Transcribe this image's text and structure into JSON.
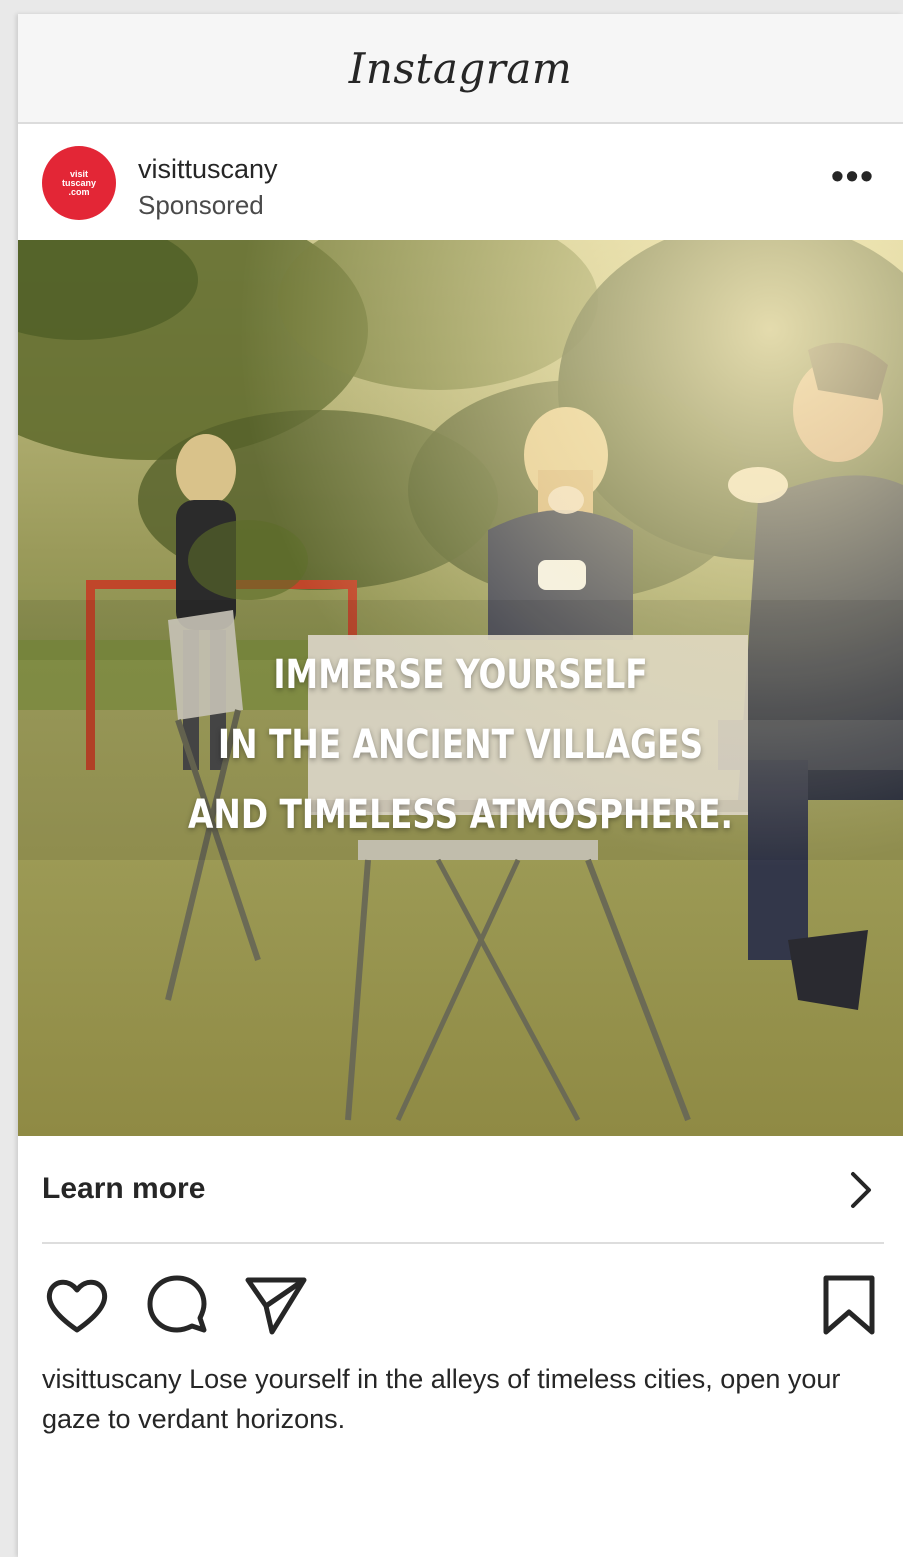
{
  "app": {
    "title": "Instagram"
  },
  "post": {
    "avatar_text": [
      "visit",
      "tuscany",
      ".com"
    ],
    "username": "visittuscany",
    "sponsored_label": "Sponsored",
    "more_label": "•••",
    "image_overlay_lines": [
      "IMMERSE YOURSELF",
      "IN THE ANCIENT VILLAGES",
      "AND TIMELESS ATMOSPHERE."
    ],
    "cta_label": "Learn more",
    "caption_username": "visittuscany",
    "caption_text": "Lose yourself in the alleys of timeless cities, open your gaze to verdant horizons."
  },
  "icons": {
    "header_more": "more-icon",
    "cta_chevron": "chevron-right-icon",
    "like": "heart-icon",
    "comment": "comment-icon",
    "share": "send-icon",
    "save": "bookmark-icon"
  },
  "colors": {
    "avatar_bg": "#e32636",
    "text_primary": "#262626",
    "header_bg": "#f6f6f6"
  }
}
